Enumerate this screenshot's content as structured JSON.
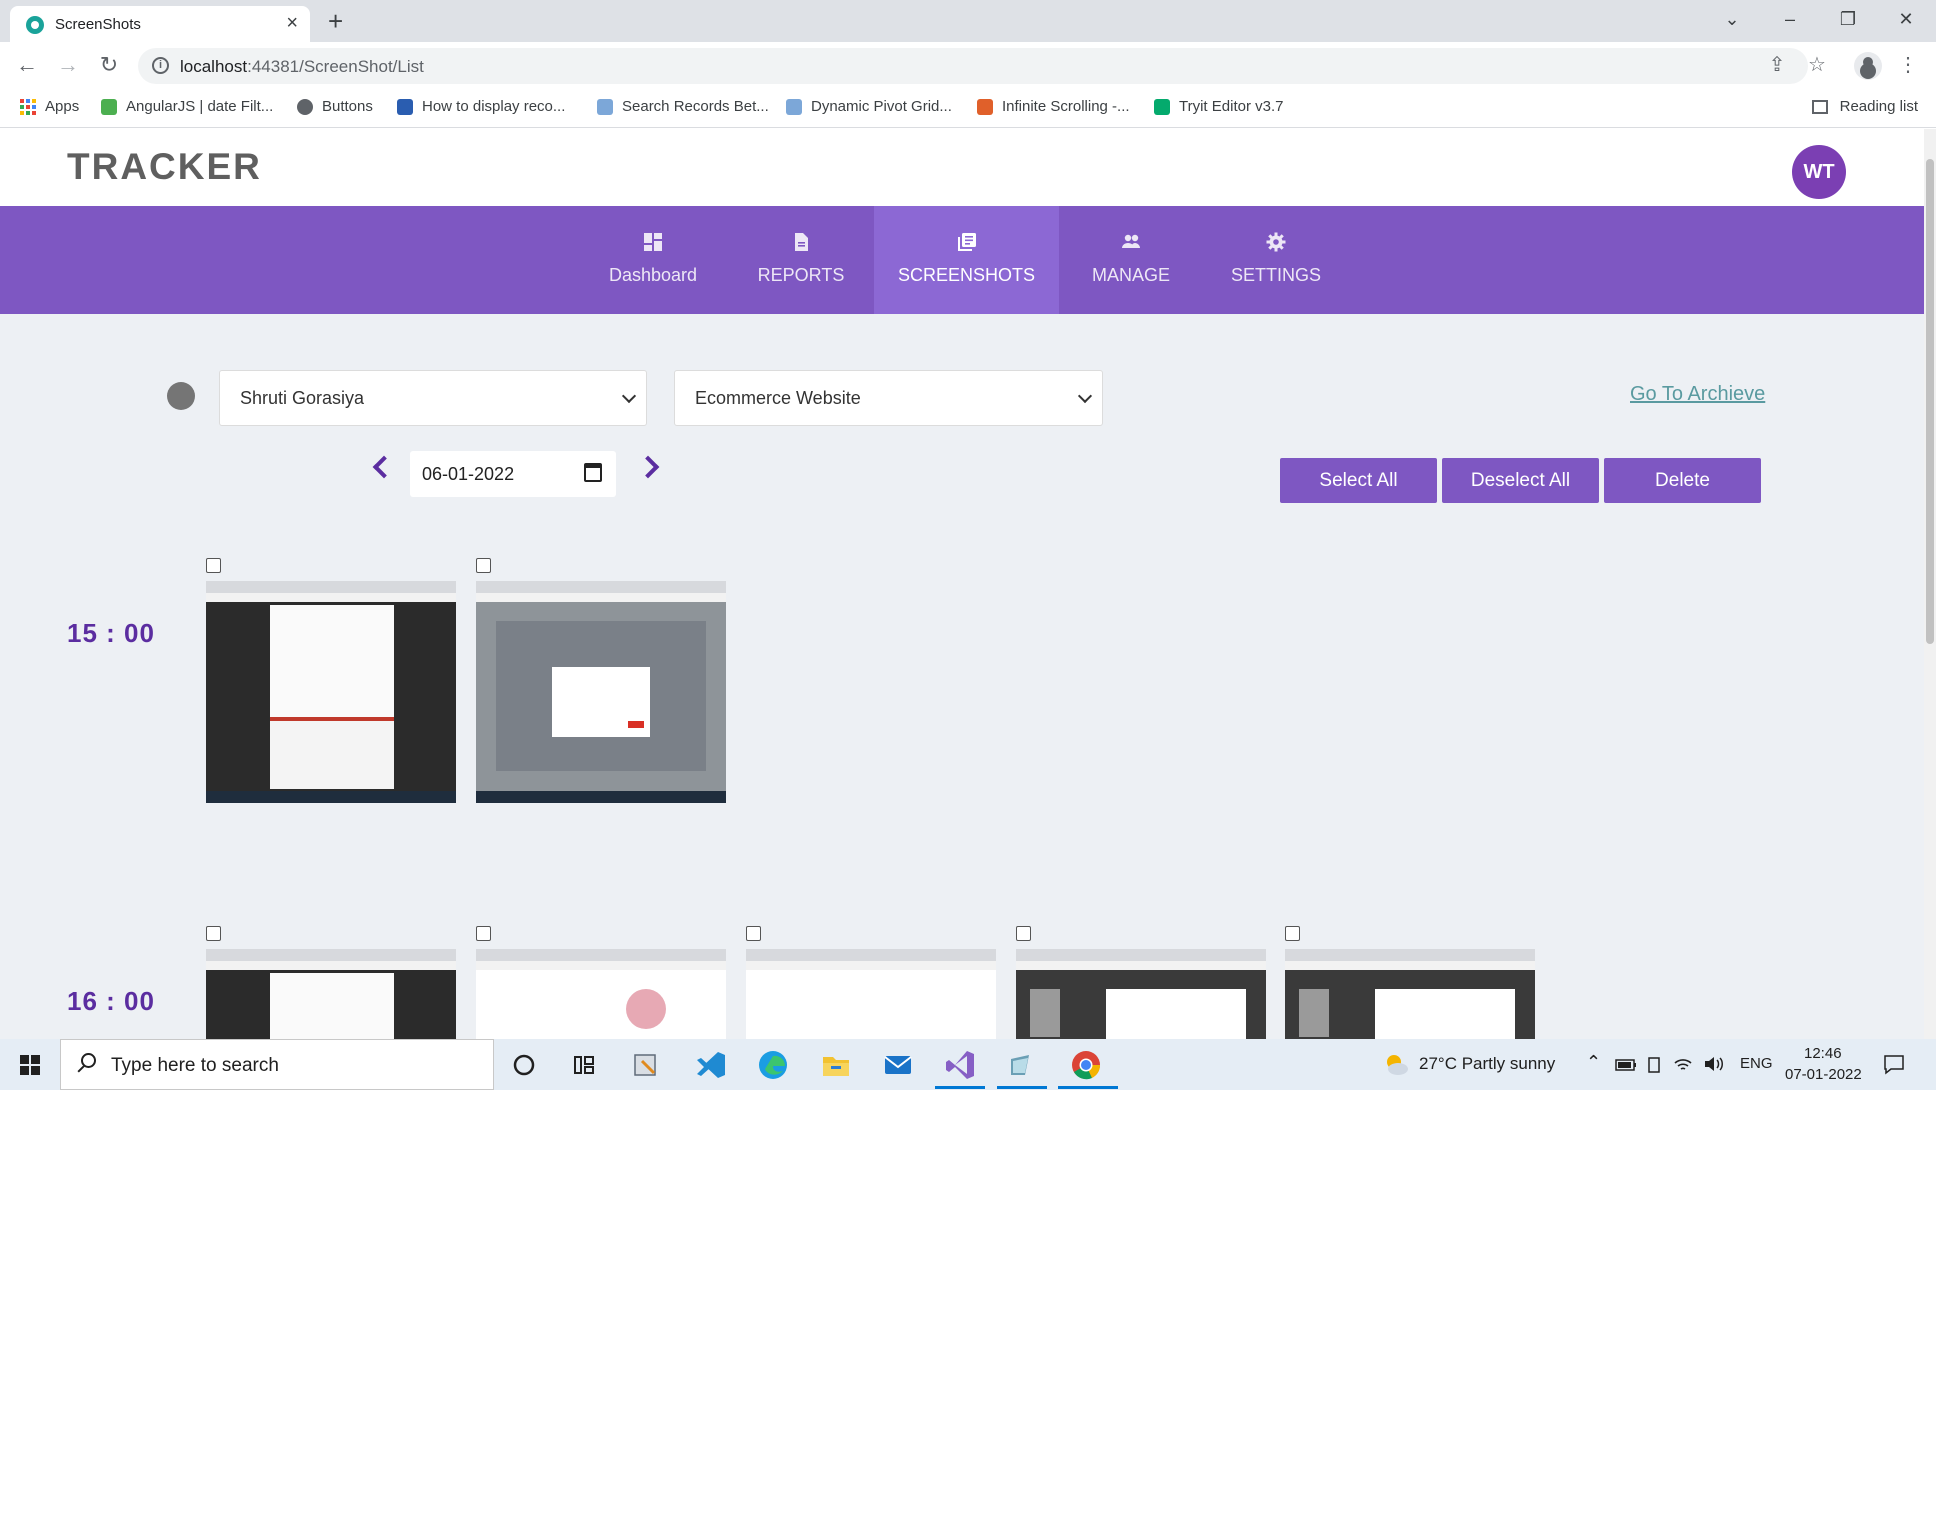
{
  "browser": {
    "tab_title": "ScreenShots",
    "url_host": "localhost",
    "url_rest": ":44381/ScreenShot/List",
    "bookmarks": [
      {
        "label": "Apps",
        "icon": "apps-grid-icon",
        "color": "#1a73e8"
      },
      {
        "label": "AngularJS | date Filt...",
        "icon": "angular-site-icon",
        "color": "#4caf50"
      },
      {
        "label": "Buttons",
        "icon": "globe-icon",
        "color": "#5f6368"
      },
      {
        "label": "How to display reco...",
        "icon": "codeproject-icon",
        "color": "#2a5db0"
      },
      {
        "label": "Search Records Bet...",
        "icon": "document-icon",
        "color": "#7ca7d8"
      },
      {
        "label": "Dynamic Pivot Grid...",
        "icon": "document-icon",
        "color": "#7ca7d8"
      },
      {
        "label": "Infinite Scrolling -...",
        "icon": "site-icon",
        "color": "#e0602a"
      },
      {
        "label": "Tryit Editor v3.7",
        "icon": "w3schools-icon",
        "color": "#04aa6d"
      }
    ],
    "reading_list": "Reading list"
  },
  "app": {
    "brand": "TRACKER",
    "avatar_initials": "WT",
    "nav": [
      {
        "label": "Dashboard",
        "icon": "dashboard-icon",
        "active": false
      },
      {
        "label": "REPORTS",
        "icon": "report-icon",
        "active": false
      },
      {
        "label": "SCREENSHOTS",
        "icon": "screenshots-icon",
        "active": true
      },
      {
        "label": "MANAGE",
        "icon": "people-icon",
        "active": false
      },
      {
        "label": "SETTINGS",
        "icon": "gear-icon",
        "active": false
      }
    ],
    "filters": {
      "user_selected": "Shruti Gorasiya",
      "project_selected": "Ecommerce Website",
      "archive_link": "Go To Archieve",
      "date": "06-01-2022"
    },
    "actions": {
      "select_all": "Select All",
      "deselect_all": "Deselect All",
      "delete": "Delete"
    },
    "hour_groups": [
      {
        "hour": "15 : 00",
        "screenshots": [
          {
            "style": "dark"
          },
          {
            "style": "blurred-dialog"
          }
        ]
      },
      {
        "hour": "16 : 00",
        "screenshots": [
          {
            "style": "dark"
          },
          {
            "style": "light"
          },
          {
            "style": "light"
          },
          {
            "style": "dark-doc"
          },
          {
            "style": "dark-doc"
          }
        ]
      }
    ],
    "accent_color": "#7e57c2"
  },
  "taskbar": {
    "search_placeholder": "Type here to search",
    "weather": "27°C  Partly sunny",
    "language": "ENG",
    "time": "12:46",
    "date": "07-01-2022"
  }
}
